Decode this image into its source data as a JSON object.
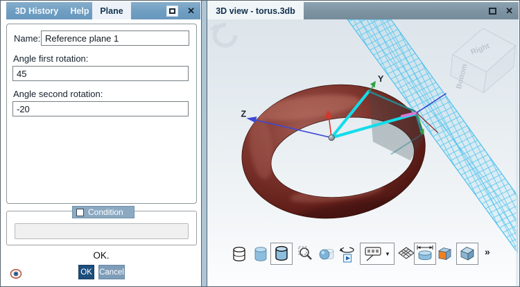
{
  "left_panel": {
    "tabs": [
      {
        "label": "3D History",
        "active": false
      },
      {
        "label": "Help",
        "active": false
      },
      {
        "label": "Plane",
        "active": true
      }
    ],
    "window": {
      "maximize_glyph": "",
      "close_glyph": "✕"
    },
    "form": {
      "name_label": "Name:",
      "name_value": "Reference plane 1",
      "angle_first_label": "Angle first rotation:",
      "angle_first_value": "45",
      "angle_second_label": "Angle second rotation:",
      "angle_second_value": "-20"
    },
    "condition": {
      "label": "Condition",
      "checked": false,
      "value": ""
    },
    "status_text": "OK.",
    "buttons": {
      "ok": "OK",
      "cancel": "Cancel"
    }
  },
  "right_panel": {
    "tab_title": "3D view - torus.3db",
    "window": {
      "maximize_glyph": "",
      "close_glyph": "✕"
    }
  },
  "scene": {
    "object": "torus",
    "axis_labels": {
      "z": "Z",
      "y": "Y"
    },
    "view_cube": {
      "top_face": "Right",
      "left_face": "Bottom"
    },
    "reference_plane": {
      "angle_first": 45,
      "angle_second": -20,
      "style": "cyan-hatched"
    }
  },
  "toolbar": {
    "more_glyph": "»",
    "dropdown_arrow_glyph": "▼",
    "icons": [
      {
        "name": "wireframe-cylinder-icon",
        "selected": false
      },
      {
        "name": "shaded-cylinder-icon",
        "selected": false
      },
      {
        "name": "shaded-outline-cylinder-icon",
        "selected": true
      },
      {
        "name": "zoom-region-icon",
        "selected": false
      },
      {
        "name": "transparency-sphere-icon",
        "selected": false
      },
      {
        "name": "orbit-animation-icon",
        "selected": false
      },
      {
        "name": "annotation-dropdown-icon",
        "selected": false
      },
      {
        "name": "mesh-render-icon",
        "selected": false
      },
      {
        "name": "measure-diameter-icon",
        "selected": true
      },
      {
        "name": "orange-face-box-icon",
        "selected": false
      },
      {
        "name": "solid-cube-icon",
        "selected": true
      }
    ]
  },
  "colors": {
    "titlebar_left": "#6f9ec2",
    "titlebar_right": "#7e93a2",
    "accent_cyan": "#14dcea",
    "hatch_cyan": "#58c4ee",
    "torus_body": "#7e352d",
    "ok_button": "#1d4e7d",
    "cancel_button": "#7e9db9",
    "condition_chip": "#8ba9c1"
  }
}
